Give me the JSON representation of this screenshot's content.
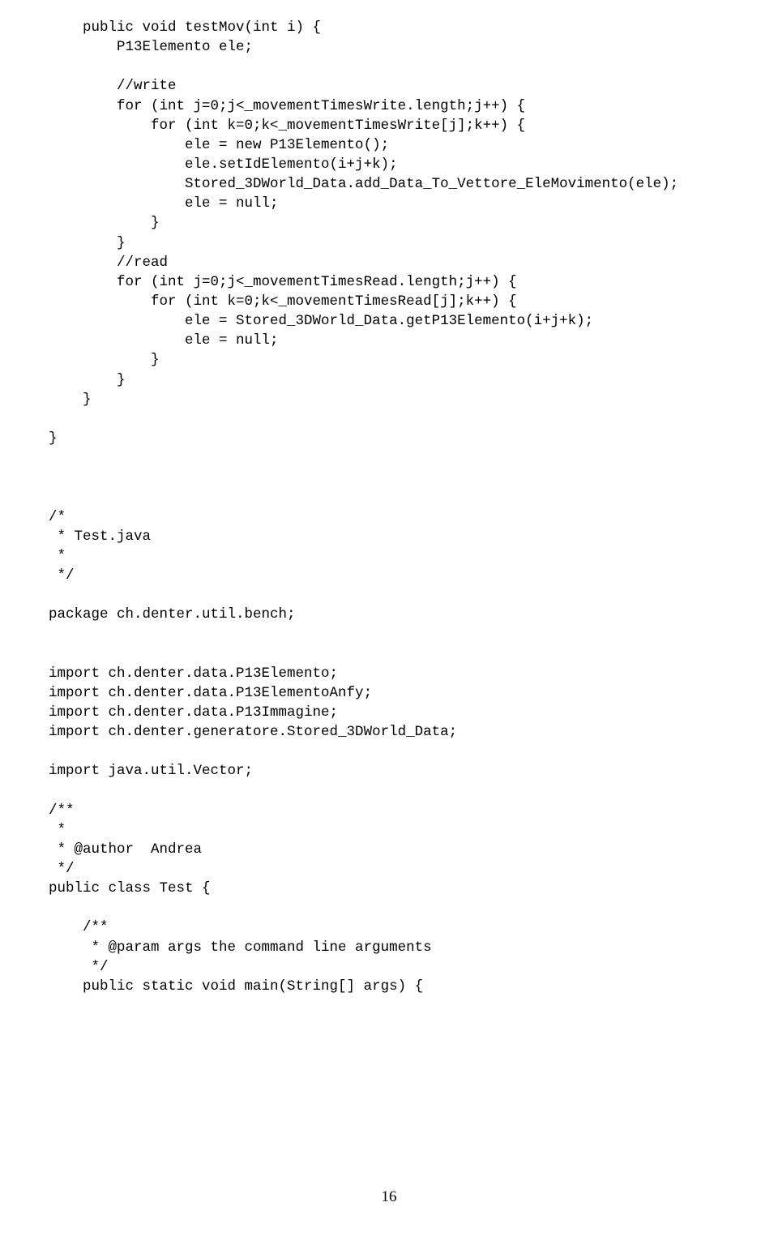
{
  "code": "    public void testMov(int i) {\n        P13Elemento ele;\n\n        //write\n        for (int j=0;j<_movementTimesWrite.length;j++) {\n            for (int k=0;k<_movementTimesWrite[j];k++) {\n                ele = new P13Elemento();\n                ele.setIdElemento(i+j+k);\n                Stored_3DWorld_Data.add_Data_To_Vettore_EleMovimento(ele);\n                ele = null;\n            }\n        }\n        //read\n        for (int j=0;j<_movementTimesRead.length;j++) {\n            for (int k=0;k<_movementTimesRead[j];k++) {\n                ele = Stored_3DWorld_Data.getP13Elemento(i+j+k);\n                ele = null;\n            }\n        }\n    }\n\n}\n\n\n\n/*\n * Test.java\n *\n */\n\npackage ch.denter.util.bench;\n\n\nimport ch.denter.data.P13Elemento;\nimport ch.denter.data.P13ElementoAnfy;\nimport ch.denter.data.P13Immagine;\nimport ch.denter.generatore.Stored_3DWorld_Data;\n\nimport java.util.Vector;\n\n/**\n *\n * @author  Andrea\n */\npublic class Test {\n\n    /**\n     * @param args the command line arguments\n     */\n    public static void main(String[] args) {",
  "page_number": "16"
}
